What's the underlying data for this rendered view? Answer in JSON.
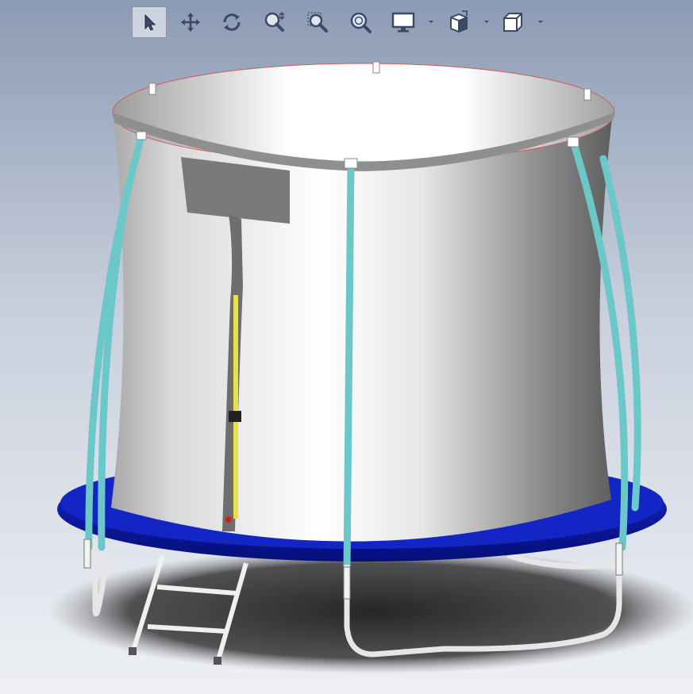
{
  "toolbar": {
    "tools": [
      {
        "icon": "select-arrow-icon",
        "active": true
      },
      {
        "icon": "pan-icon",
        "active": false
      },
      {
        "icon": "rotate-view-icon",
        "active": false
      },
      {
        "icon": "zoom-in-out-icon",
        "active": false
      },
      {
        "icon": "zoom-to-area-icon",
        "active": false
      },
      {
        "icon": "zoom-to-fit-icon",
        "active": false
      },
      {
        "icon": "display-style-icon",
        "active": false,
        "dropdown": true
      },
      {
        "icon": "view-orientation-icon",
        "active": false,
        "dropdown": true
      },
      {
        "icon": "standard-views-cube-icon",
        "active": false,
        "dropdown": true
      }
    ]
  },
  "model": {
    "colors": {
      "enclosure": "#e8e8e8",
      "pole": "#6cc8c8",
      "pad": "#0a1ea0",
      "frame": "#e6e6e6",
      "zipper": "#e8e04a"
    }
  }
}
